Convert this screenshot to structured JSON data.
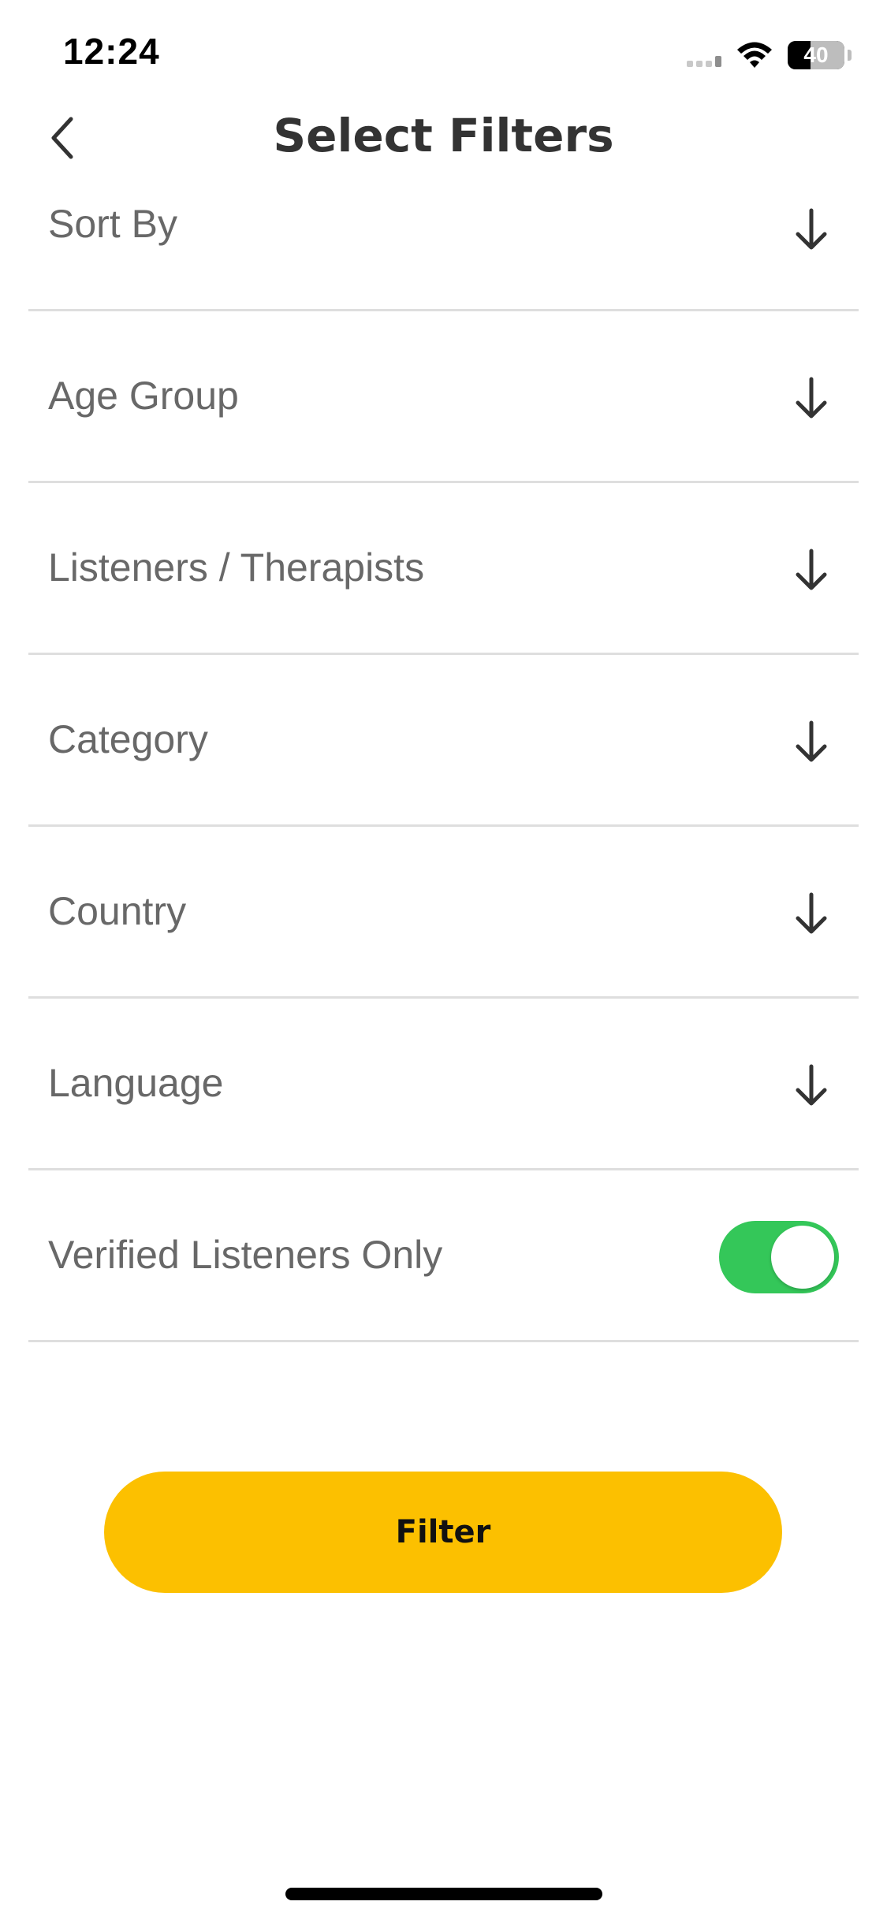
{
  "status_bar": {
    "time": "12:24",
    "battery_text": "40",
    "battery_percent": 40,
    "signal_icon": "cellular-signal-icon",
    "wifi_icon": "wifi-icon",
    "battery_icon": "battery-icon"
  },
  "header": {
    "title": "Select Filters",
    "back_icon": "chevron-left-icon"
  },
  "filters": [
    {
      "label": "Sort By",
      "icon": "arrow-down-icon"
    },
    {
      "label": "Age Group",
      "icon": "arrow-down-icon"
    },
    {
      "label": "Listeners / Therapists",
      "icon": "arrow-down-icon"
    },
    {
      "label": "Category",
      "icon": "arrow-down-icon"
    },
    {
      "label": "Country",
      "icon": "arrow-down-icon"
    },
    {
      "label": "Language",
      "icon": "arrow-down-icon"
    }
  ],
  "verified_toggle": {
    "label": "Verified Listeners Only",
    "enabled": true,
    "on_color": "#34c759"
  },
  "actions": {
    "filter_label": "Filter",
    "filter_color": "#fcc000"
  }
}
